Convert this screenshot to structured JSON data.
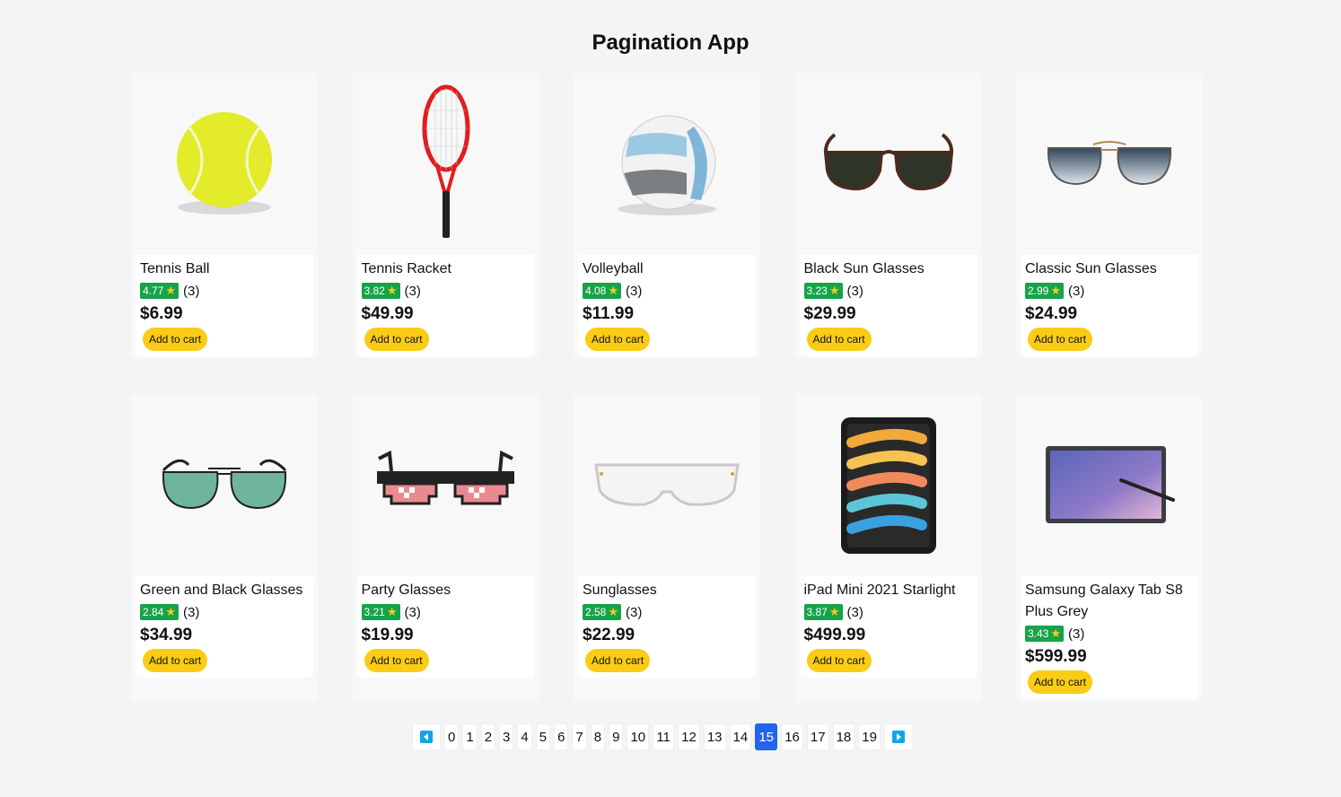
{
  "app": {
    "title": "Pagination App"
  },
  "products": [
    {
      "name": "Tennis Ball",
      "rating": "4.77",
      "count": "(3)",
      "price": "$6.99",
      "icon": "tennis-ball"
    },
    {
      "name": "Tennis Racket",
      "rating": "3.82",
      "count": "(3)",
      "price": "$49.99",
      "icon": "tennis-racket"
    },
    {
      "name": "Volleyball",
      "rating": "4.08",
      "count": "(3)",
      "price": "$11.99",
      "icon": "volleyball"
    },
    {
      "name": "Black Sun Glasses",
      "rating": "3.23",
      "count": "(3)",
      "price": "$29.99",
      "icon": "black-sun-glasses"
    },
    {
      "name": "Classic Sun Glasses",
      "rating": "2.99",
      "count": "(3)",
      "price": "$24.99",
      "icon": "classic-sun-glasses"
    },
    {
      "name": "Green and Black Glasses",
      "rating": "2.84",
      "count": "(3)",
      "price": "$34.99",
      "icon": "green-black-glasses"
    },
    {
      "name": "Party Glasses",
      "rating": "3.21",
      "count": "(3)",
      "price": "$19.99",
      "icon": "party-glasses"
    },
    {
      "name": "Sunglasses",
      "rating": "2.58",
      "count": "(3)",
      "price": "$22.99",
      "icon": "sunglasses"
    },
    {
      "name": "iPad Mini 2021 Starlight",
      "rating": "3.87",
      "count": "(3)",
      "price": "$499.99",
      "icon": "ipad-mini"
    },
    {
      "name": "Samsung Galaxy Tab S8 Plus Grey",
      "rating": "3.43",
      "count": "(3)",
      "price": "$599.99",
      "icon": "galaxy-tab"
    }
  ],
  "cart_label": "Add to cart",
  "pagination": {
    "pages": [
      "0",
      "1",
      "2",
      "3",
      "4",
      "5",
      "6",
      "7",
      "8",
      "9",
      "10",
      "11",
      "12",
      "13",
      "14",
      "15",
      "16",
      "17",
      "18",
      "19"
    ],
    "current": "15"
  },
  "colors": {
    "accent": "#2563eb",
    "rating": "#16a34a",
    "button": "#facc15",
    "arrow": "#0ea5e9"
  }
}
